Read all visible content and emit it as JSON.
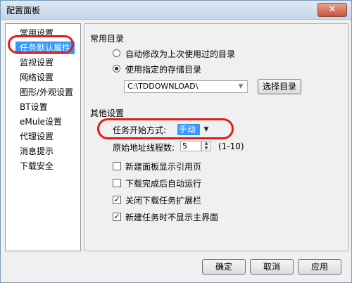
{
  "window": {
    "title": "配置面板",
    "close_label": "✕"
  },
  "sidebar": {
    "items": [
      {
        "label": "常用设置"
      },
      {
        "label": "任务默认属性"
      },
      {
        "label": "监视设置"
      },
      {
        "label": "网络设置"
      },
      {
        "label": "图形/外观设置"
      },
      {
        "label": "BT设置"
      },
      {
        "label": "eMule设置"
      },
      {
        "label": "代理设置"
      },
      {
        "label": "消息提示"
      },
      {
        "label": "下载安全"
      }
    ],
    "selected_index": 1
  },
  "panel": {
    "common_dir": {
      "heading": "常用目录",
      "radio_auto": "自动修改为上次使用过的目录",
      "radio_specified": "使用指定的存储目录",
      "path_value": "C:\\TDDOWNLOAD\\",
      "browse_label": "选择目录"
    },
    "other": {
      "heading": "其他设置",
      "start_mode_label": "任务开始方式:",
      "start_mode_value": "手动",
      "threads_label": "原始地址线程数:",
      "threads_value": "5",
      "threads_range": "(1-10)",
      "checkboxes": [
        {
          "label": "新建面板显示引用页",
          "checked": false
        },
        {
          "label": "下载完成后自动运行",
          "checked": false
        },
        {
          "label": "关闭下载任务扩展栏",
          "checked": true
        },
        {
          "label": "新建任务时不显示主界面",
          "checked": true
        }
      ]
    }
  },
  "footer": {
    "ok_label": "确定",
    "cancel_label": "取消",
    "apply_label": "应用"
  },
  "colors": {
    "highlight": "#3399ff",
    "annotation_ring": "#e21d1d"
  }
}
